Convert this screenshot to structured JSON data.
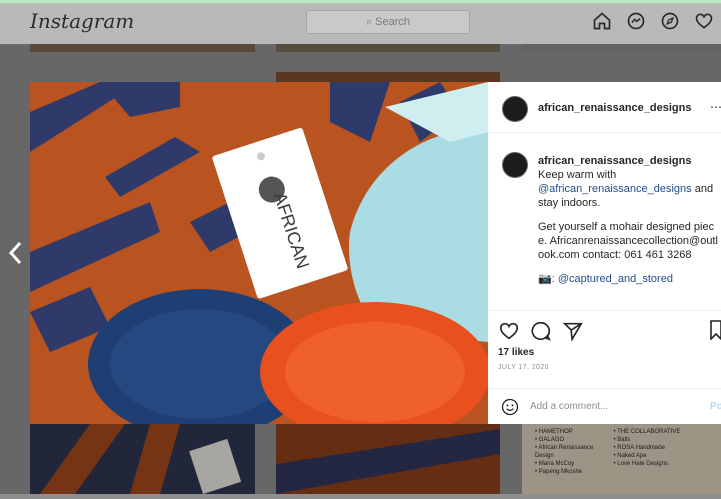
{
  "topbar": {
    "logo": "Instagram",
    "search_placeholder": "Search"
  },
  "post": {
    "username": "african_renaissance_designs",
    "caption": {
      "username": "african_renaissance_designs",
      "line1": " Keep warm with ",
      "mention": "@african_renaissance_designs",
      "line1b": " and stay indoors.",
      "line2": "Get yourself a mohair designed piece. Africanrenaissancecollection@outlook.com contact: 061 461 3268",
      "credit_icon": "📷",
      "credit": ": @captured_and_stored"
    },
    "likes": "17 likes",
    "date": "JULY 17, 2020",
    "comment_placeholder": "Add a comment...",
    "post_label": "Po",
    "tag_text": "AFRICAN"
  },
  "background_text": {
    "left_col": [
      "• HAMETHOP",
      "• GALAGO",
      "• African Renaissance",
      "  Design",
      "• Mana McCoy",
      "• Papeng Mkoshe"
    ],
    "right_col": [
      "• THE COLLABORATIVE",
      "• Balls",
      "• ROSA Handmade",
      "• Naked Ape",
      "• Love Hate Designs"
    ]
  },
  "colors": {
    "scrim": "#000000",
    "mention": "#1f4d8e",
    "knit_orange": "#b9531f",
    "knit_navy": "#2f3a6b",
    "yarn_blue": "#1f3f74",
    "mint": "#a9dde3"
  }
}
